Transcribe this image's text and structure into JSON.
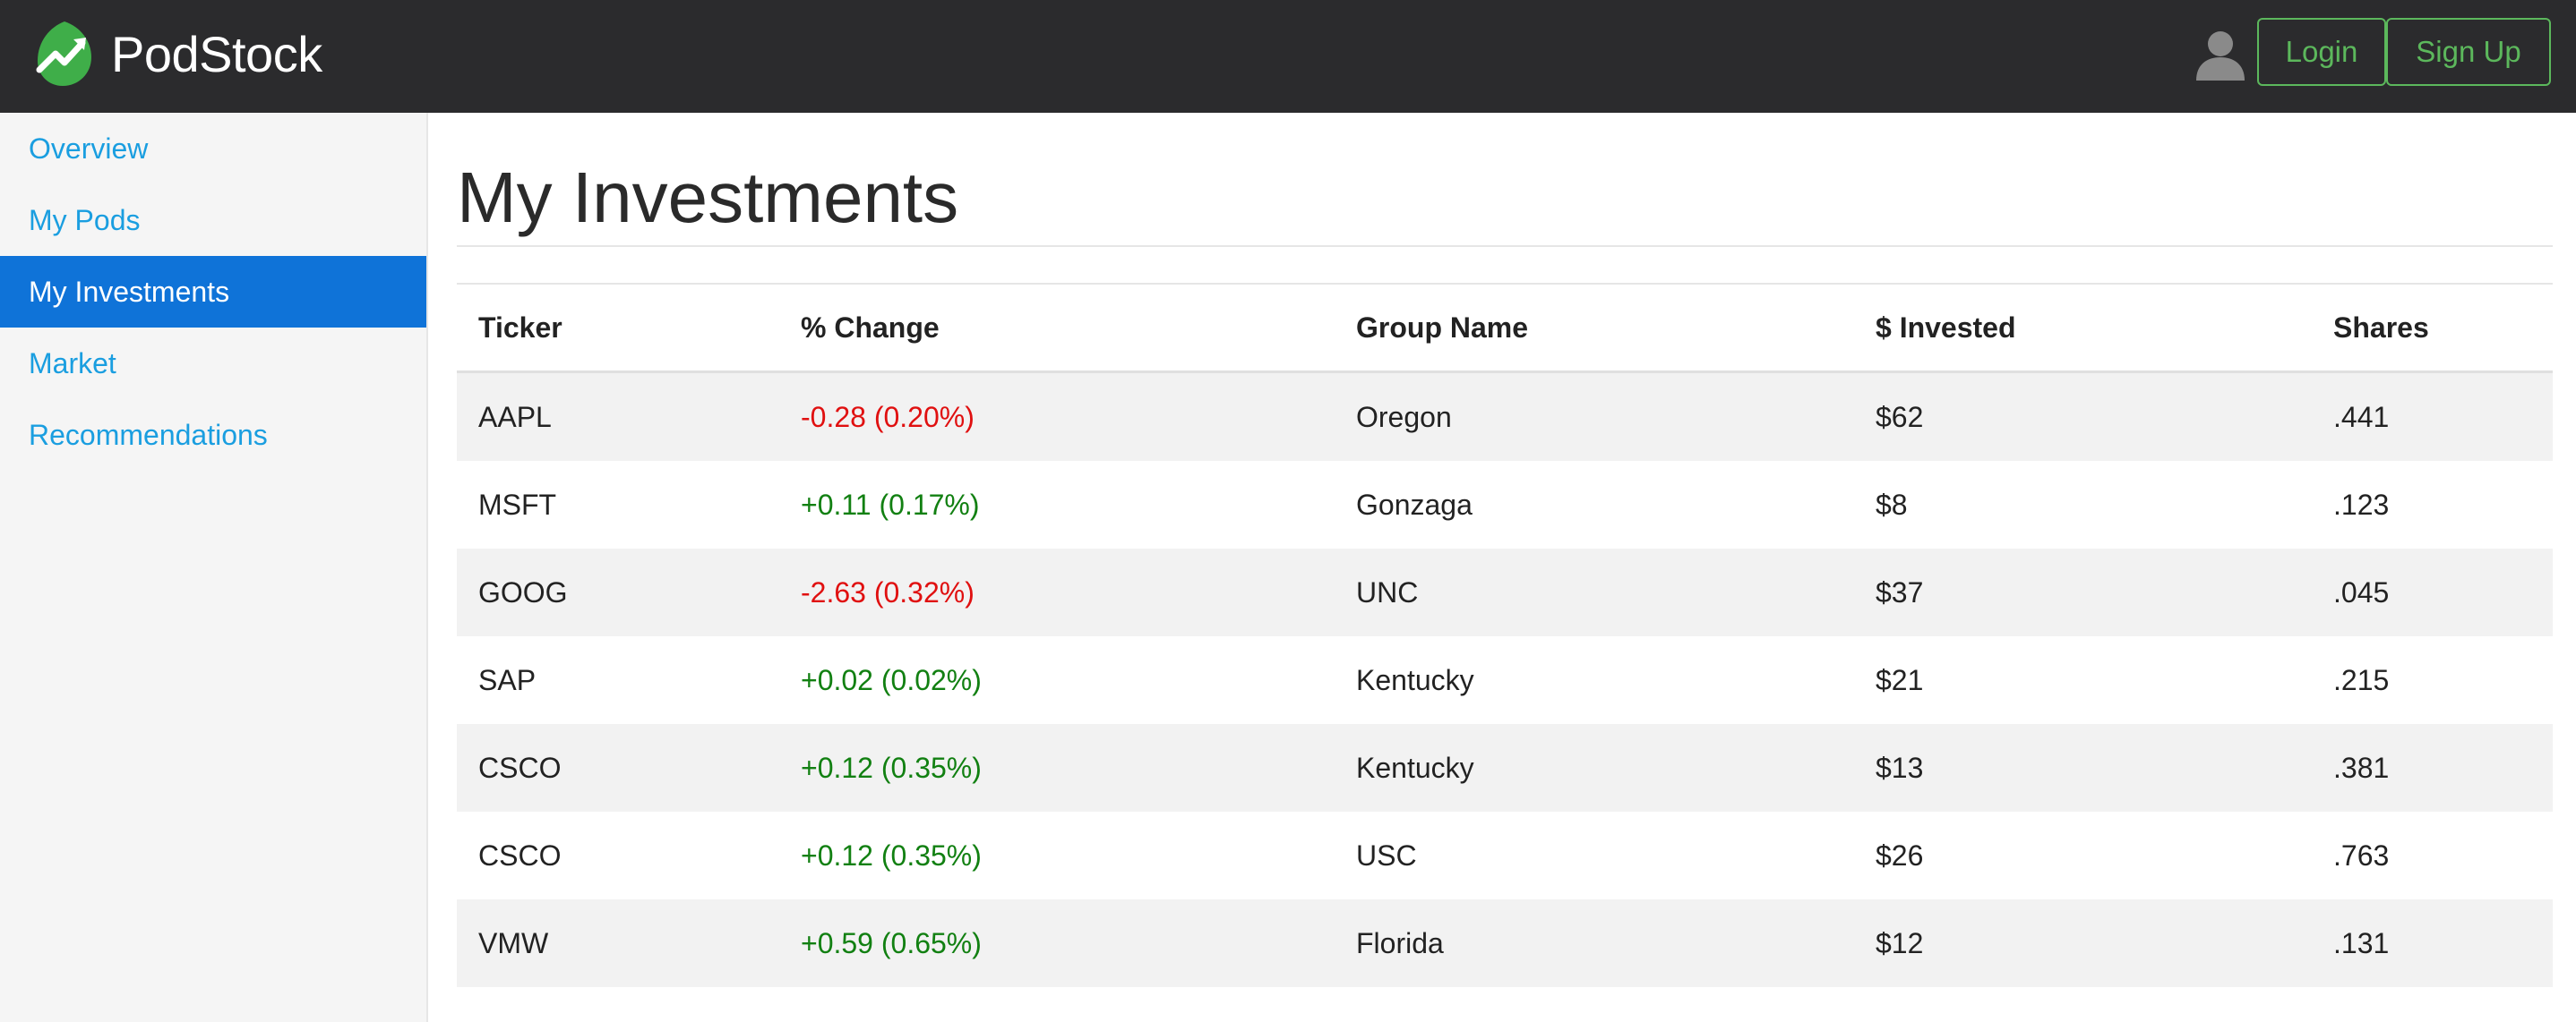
{
  "app": {
    "name": "PodStock",
    "accent_color": "#5cb85c",
    "logo_icon": "trending-up-leaf-logo",
    "user_icon": "user-silhouette-icon"
  },
  "header": {
    "login_label": "Login",
    "signup_label": "Sign Up"
  },
  "sidebar": {
    "items": [
      {
        "label": "Overview",
        "active": false
      },
      {
        "label": "My Pods",
        "active": false
      },
      {
        "label": "My Investments",
        "active": true
      },
      {
        "label": "Market",
        "active": false
      },
      {
        "label": "Recommendations",
        "active": false
      }
    ]
  },
  "main": {
    "title": "My Investments",
    "table": {
      "columns": [
        "Ticker",
        "% Change",
        "Group Name",
        "$ Invested",
        "Shares"
      ],
      "rows": [
        {
          "ticker": "AAPL",
          "change": "-0.28 (0.20%)",
          "direction": "down",
          "group": "Oregon",
          "invested": "$62",
          "shares": ".441"
        },
        {
          "ticker": "MSFT",
          "change": "+0.11 (0.17%)",
          "direction": "up",
          "group": "Gonzaga",
          "invested": "$8",
          "shares": ".123"
        },
        {
          "ticker": "GOOG",
          "change": "-2.63 (0.32%)",
          "direction": "down",
          "group": "UNC",
          "invested": "$37",
          "shares": ".045"
        },
        {
          "ticker": "SAP",
          "change": "+0.02 (0.02%)",
          "direction": "up",
          "group": "Kentucky",
          "invested": "$21",
          "shares": ".215"
        },
        {
          "ticker": "CSCO",
          "change": "+0.12 (0.35%)",
          "direction": "up",
          "group": "Kentucky",
          "invested": "$13",
          "shares": ".381"
        },
        {
          "ticker": "CSCO",
          "change": "+0.12 (0.35%)",
          "direction": "up",
          "group": "USC",
          "invested": "$26",
          "shares": ".763"
        },
        {
          "ticker": "VMW",
          "change": "+0.59 (0.65%)",
          "direction": "up",
          "group": "Florida",
          "invested": "$12",
          "shares": ".131"
        }
      ],
      "colors": {
        "up": "#128012",
        "down": "#e01010"
      }
    }
  }
}
